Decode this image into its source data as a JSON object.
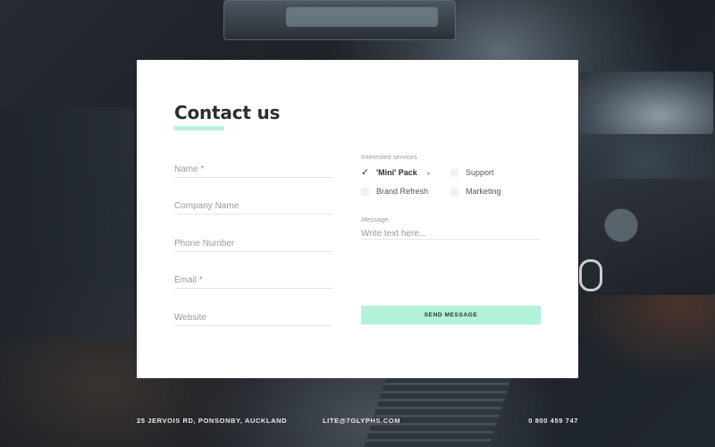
{
  "form": {
    "title": "Contact us",
    "fields": {
      "name_placeholder": "Name *",
      "company_placeholder": "Company Name",
      "phone_placeholder": "Phone Number",
      "email_placeholder": "Email *",
      "website_placeholder": "Website"
    },
    "services": {
      "label": "Interested services",
      "items": [
        {
          "label": "'Mini' Pack",
          "checked": true
        },
        {
          "label": "Support",
          "checked": false
        },
        {
          "label": "Brand Refresh",
          "checked": false
        },
        {
          "label": "Marketing",
          "checked": false
        }
      ]
    },
    "message": {
      "label": "Message",
      "placeholder": "Write text here..."
    },
    "send_label": "SEND MESSAGE"
  },
  "footer": {
    "address": "25 JERVOIS RD, PONSONBY, AUCKLAND",
    "email": "LITE@7GLYPHS.COM",
    "phone": "0 800 459 747"
  },
  "colors": {
    "accent": "#b2f2d8",
    "card_bg": "#ffffff",
    "title": "#2d2d33"
  },
  "icons": {
    "check": "checkmark-icon",
    "chevron": "chevron-down-icon"
  }
}
